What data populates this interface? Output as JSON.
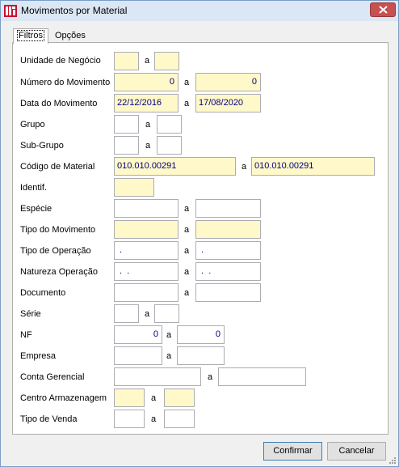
{
  "window": {
    "title": "Movimentos por Material",
    "app_icon": "app-logo-icon",
    "close_icon": "close-icon"
  },
  "tabs": [
    {
      "label": "Filtros",
      "active": true
    },
    {
      "label": "Opções",
      "active": false
    }
  ],
  "separator": "a",
  "fields": {
    "unidade_negocio": {
      "label": "Unidade de Negócio",
      "from": "",
      "to": ""
    },
    "numero_movimento": {
      "label": "Número do Movimento",
      "from": "0",
      "to": "0"
    },
    "data_movimento": {
      "label": "Data do Movimento",
      "from": "22/12/2016",
      "to": "17/08/2020"
    },
    "grupo": {
      "label": "Grupo",
      "from": "",
      "to": ""
    },
    "sub_grupo": {
      "label": "Sub-Grupo",
      "from": "",
      "to": ""
    },
    "codigo_material": {
      "label": "Código de Material",
      "from": "010.010.00291",
      "to": "010.010.00291"
    },
    "identif": {
      "label": "Identif.",
      "value": ""
    },
    "especie": {
      "label": "Espécie",
      "from": "",
      "to": ""
    },
    "tipo_movimento": {
      "label": "Tipo do Movimento",
      "from": "",
      "to": ""
    },
    "tipo_operacao": {
      "label": "Tipo de Operação",
      "from": " .",
      "to": " ."
    },
    "natureza_operacao": {
      "label": "Natureza Operação",
      "from": " .  .",
      "to": " .  ."
    },
    "documento": {
      "label": "Documento",
      "from": "",
      "to": ""
    },
    "serie": {
      "label": "Série",
      "from": "",
      "to": ""
    },
    "nf": {
      "label": "NF",
      "from": "0",
      "to": "0"
    },
    "empresa": {
      "label": "Empresa",
      "from": "",
      "to": ""
    },
    "conta_gerencial": {
      "label": "Conta Gerencial",
      "from": "",
      "to": ""
    },
    "centro_armazenagem": {
      "label": "Centro Armazenagem",
      "from": "",
      "to": ""
    },
    "tipo_venda": {
      "label": "Tipo de Venda",
      "from": "",
      "to": ""
    }
  },
  "buttons": {
    "confirm": "Confirmar",
    "cancel": "Cancelar"
  }
}
